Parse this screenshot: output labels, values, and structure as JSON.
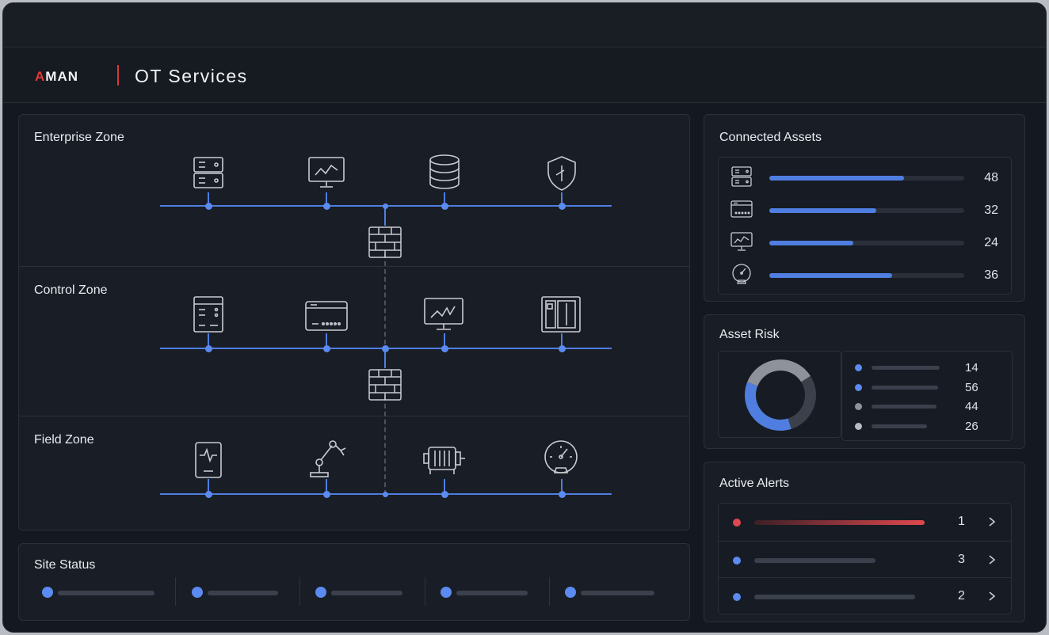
{
  "header": {
    "logo_prefix": "A",
    "logo_rest": "MAN",
    "title": "OT Services"
  },
  "network": {
    "zones": [
      {
        "title": "Enterprise Zone",
        "devices": [
          "server-icon",
          "monitor-chart-icon",
          "database-icon",
          "shield-icon"
        ]
      },
      {
        "title": "Control Zone",
        "devices": [
          "plc-controller-icon",
          "io-module-icon",
          "hmi-monitor-icon",
          "control-cabinet-icon"
        ]
      },
      {
        "title": "Field Zone",
        "devices": [
          "sensor-icon",
          "robot-arm-icon",
          "motor-icon",
          "gauge-icon"
        ]
      }
    ],
    "firewalls": [
      "firewall-icon",
      "firewall-icon"
    ],
    "colors": {
      "bus": "#4f7ee0",
      "node": "#5b8af0"
    }
  },
  "site_status": {
    "title": "Site Status",
    "items": [
      {
        "status_color": "#5b8af0",
        "level": 1.0
      },
      {
        "status_color": "#5b8af0",
        "level": 1.0
      },
      {
        "status_color": "#5b8af0",
        "level": 1.0
      },
      {
        "status_color": "#5b8af0",
        "level": 1.0
      },
      {
        "status_color": "#5b8af0",
        "level": 1.0
      }
    ]
  },
  "connected_assets": {
    "title": "Connected Assets",
    "rows": [
      {
        "icon": "server-icon",
        "value": "48",
        "level": 0.69
      },
      {
        "icon": "io-module-icon",
        "value": "32",
        "level": 0.55
      },
      {
        "icon": "monitor-chart-icon",
        "value": "24",
        "level": 0.43
      },
      {
        "icon": "gauge-icon",
        "value": "36",
        "level": 0.63
      }
    ]
  },
  "asset_risk": {
    "title": "Asset Risk",
    "legend": [
      {
        "value": "14",
        "color": "#5b8af0"
      },
      {
        "value": "56",
        "color": "#5b8af0"
      },
      {
        "value": "44",
        "color": "#8d929b"
      },
      {
        "value": "26",
        "color": "#b7bbc2"
      }
    ],
    "donut_segments": [
      {
        "fraction": 0.36,
        "color": "#4f7ee0"
      },
      {
        "fraction": 0.35,
        "color": "#8d929b"
      },
      {
        "fraction": 0.29,
        "color": "#3b404a"
      }
    ]
  },
  "active_alerts": {
    "title": "Active Alerts",
    "rows": [
      {
        "value": "1",
        "color": "#e0484f",
        "severity": "critical"
      },
      {
        "value": "3",
        "color": "#5b8af0",
        "severity": "normal"
      },
      {
        "value": "2",
        "color": "#5b8af0",
        "severity": "normal"
      }
    ]
  }
}
